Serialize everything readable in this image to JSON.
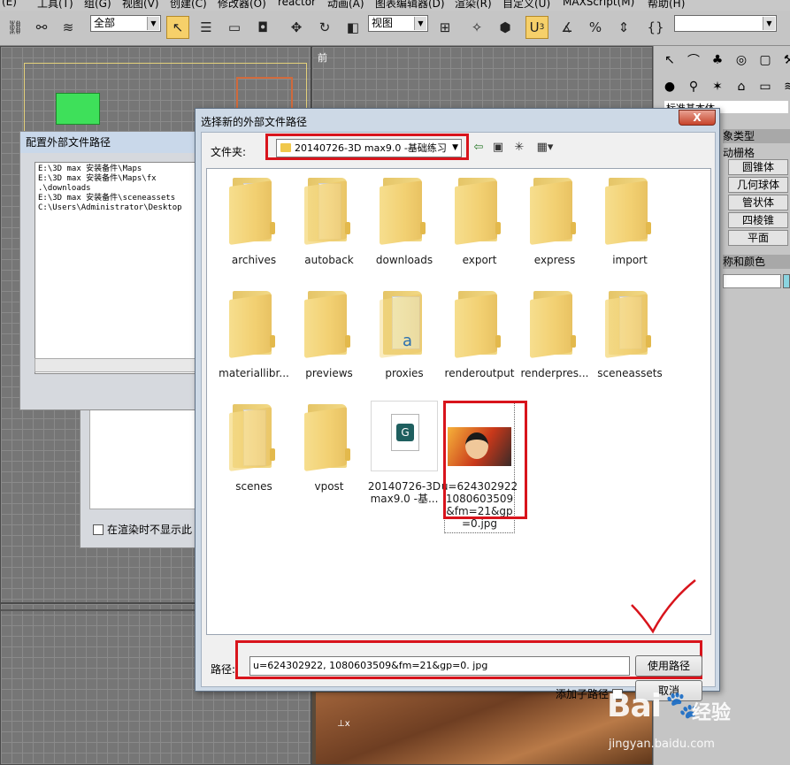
{
  "menubar": {
    "items": [
      "(E)",
      "工具(T)",
      "组(G)",
      "视图(V)",
      "创建(C)",
      "修改器(O)",
      "reactor",
      "动画(A)",
      "图表编辑器(D)",
      "渲染(R)",
      "自定义(U)",
      "MAXScript(M)",
      "帮助(H)"
    ]
  },
  "toolbar": {
    "selection_filter": "全部",
    "reference_coord": "视图",
    "snap_badge": "3"
  },
  "viewports": {
    "front_label": "前"
  },
  "command_panel": {
    "header_partial": "标准基本体",
    "section_object_type": "象类型",
    "autogrid": "动栅格",
    "buttons": [
      "圆锥体",
      "几何球体",
      "管状体",
      "四棱锥",
      "平面"
    ],
    "section_name_color": "称和颜色"
  },
  "bg_dialog": {
    "title": "配置外部文件路径",
    "paths": [
      "E:\\3D max 安装备件\\Maps",
      "E:\\3D max 安装备件\\Maps\\fx",
      ".\\downloads",
      "E:\\3D max 安装备件\\sceneassets",
      "C:\\Users\\Administrator\\Desktop"
    ],
    "render_checkbox_label": "在渲染时不显示此"
  },
  "dialog": {
    "title": "选择新的外部文件路径",
    "close_label": "X",
    "folder_label": "文件夹:",
    "folder_value": "20140726-3D max9.0 -基础练习",
    "items": [
      {
        "label": "archives",
        "kind": "folder"
      },
      {
        "label": "autoback",
        "kind": "folder-docs"
      },
      {
        "label": "downloads",
        "kind": "folder"
      },
      {
        "label": "export",
        "kind": "folder"
      },
      {
        "label": "express",
        "kind": "folder"
      },
      {
        "label": "import",
        "kind": "folder"
      },
      {
        "label": "materiallibr...",
        "kind": "folder"
      },
      {
        "label": "previews",
        "kind": "folder"
      },
      {
        "label": "proxies",
        "kind": "folder-sheet"
      },
      {
        "label": "renderoutput",
        "kind": "folder"
      },
      {
        "label": "renderpres...",
        "kind": "folder"
      },
      {
        "label": "sceneassets",
        "kind": "folder-docs"
      },
      {
        "label": "scenes",
        "kind": "folder-docs"
      },
      {
        "label": "vpost",
        "kind": "folder"
      },
      {
        "label": "20140726-3D max9.0 -基...",
        "kind": "max-file"
      },
      {
        "label": "u=624302922 1080603509 &fm=21&gp =0.jpg",
        "kind": "image"
      }
    ],
    "path_label": "路径:",
    "path_value": "u=624302922, 1080603509&fm=21&gp=0. jpg",
    "use_path_button": "使用路径",
    "add_subpath_label": "添加子路径",
    "cancel_button": "取消"
  },
  "watermark": {
    "logo": "Bai",
    "cn": "经验",
    "url": "jingyan.baidu.com"
  },
  "colors": {
    "highlight": "#d8141c",
    "dialog_frame": "#cdd9e6",
    "active_tool": "#f6d06a"
  }
}
